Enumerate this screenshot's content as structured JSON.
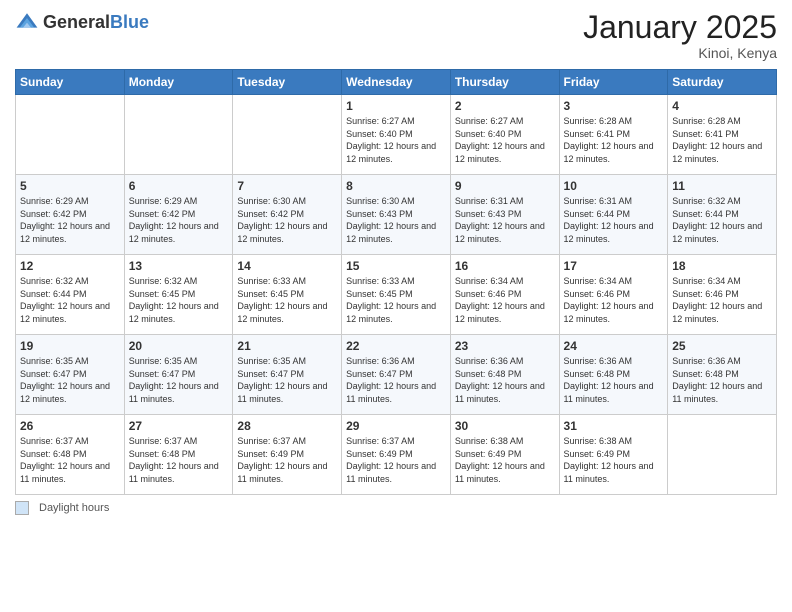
{
  "header": {
    "logo_general": "General",
    "logo_blue": "Blue",
    "month_title": "January 2025",
    "location": "Kinoi, Kenya"
  },
  "days_of_week": [
    "Sunday",
    "Monday",
    "Tuesday",
    "Wednesday",
    "Thursday",
    "Friday",
    "Saturday"
  ],
  "footer": {
    "box_label": "Daylight hours"
  },
  "weeks": [
    [
      {
        "day": "",
        "sunrise": "",
        "sunset": "",
        "daylight": ""
      },
      {
        "day": "",
        "sunrise": "",
        "sunset": "",
        "daylight": ""
      },
      {
        "day": "",
        "sunrise": "",
        "sunset": "",
        "daylight": ""
      },
      {
        "day": "1",
        "sunrise": "6:27 AM",
        "sunset": "6:40 PM",
        "daylight": "12 hours and 12 minutes."
      },
      {
        "day": "2",
        "sunrise": "6:27 AM",
        "sunset": "6:40 PM",
        "daylight": "12 hours and 12 minutes."
      },
      {
        "day": "3",
        "sunrise": "6:28 AM",
        "sunset": "6:41 PM",
        "daylight": "12 hours and 12 minutes."
      },
      {
        "day": "4",
        "sunrise": "6:28 AM",
        "sunset": "6:41 PM",
        "daylight": "12 hours and 12 minutes."
      }
    ],
    [
      {
        "day": "5",
        "sunrise": "6:29 AM",
        "sunset": "6:42 PM",
        "daylight": "12 hours and 12 minutes."
      },
      {
        "day": "6",
        "sunrise": "6:29 AM",
        "sunset": "6:42 PM",
        "daylight": "12 hours and 12 minutes."
      },
      {
        "day": "7",
        "sunrise": "6:30 AM",
        "sunset": "6:42 PM",
        "daylight": "12 hours and 12 minutes."
      },
      {
        "day": "8",
        "sunrise": "6:30 AM",
        "sunset": "6:43 PM",
        "daylight": "12 hours and 12 minutes."
      },
      {
        "day": "9",
        "sunrise": "6:31 AM",
        "sunset": "6:43 PM",
        "daylight": "12 hours and 12 minutes."
      },
      {
        "day": "10",
        "sunrise": "6:31 AM",
        "sunset": "6:44 PM",
        "daylight": "12 hours and 12 minutes."
      },
      {
        "day": "11",
        "sunrise": "6:32 AM",
        "sunset": "6:44 PM",
        "daylight": "12 hours and 12 minutes."
      }
    ],
    [
      {
        "day": "12",
        "sunrise": "6:32 AM",
        "sunset": "6:44 PM",
        "daylight": "12 hours and 12 minutes."
      },
      {
        "day": "13",
        "sunrise": "6:32 AM",
        "sunset": "6:45 PM",
        "daylight": "12 hours and 12 minutes."
      },
      {
        "day": "14",
        "sunrise": "6:33 AM",
        "sunset": "6:45 PM",
        "daylight": "12 hours and 12 minutes."
      },
      {
        "day": "15",
        "sunrise": "6:33 AM",
        "sunset": "6:45 PM",
        "daylight": "12 hours and 12 minutes."
      },
      {
        "day": "16",
        "sunrise": "6:34 AM",
        "sunset": "6:46 PM",
        "daylight": "12 hours and 12 minutes."
      },
      {
        "day": "17",
        "sunrise": "6:34 AM",
        "sunset": "6:46 PM",
        "daylight": "12 hours and 12 minutes."
      },
      {
        "day": "18",
        "sunrise": "6:34 AM",
        "sunset": "6:46 PM",
        "daylight": "12 hours and 12 minutes."
      }
    ],
    [
      {
        "day": "19",
        "sunrise": "6:35 AM",
        "sunset": "6:47 PM",
        "daylight": "12 hours and 12 minutes."
      },
      {
        "day": "20",
        "sunrise": "6:35 AM",
        "sunset": "6:47 PM",
        "daylight": "12 hours and 11 minutes."
      },
      {
        "day": "21",
        "sunrise": "6:35 AM",
        "sunset": "6:47 PM",
        "daylight": "12 hours and 11 minutes."
      },
      {
        "day": "22",
        "sunrise": "6:36 AM",
        "sunset": "6:47 PM",
        "daylight": "12 hours and 11 minutes."
      },
      {
        "day": "23",
        "sunrise": "6:36 AM",
        "sunset": "6:48 PM",
        "daylight": "12 hours and 11 minutes."
      },
      {
        "day": "24",
        "sunrise": "6:36 AM",
        "sunset": "6:48 PM",
        "daylight": "12 hours and 11 minutes."
      },
      {
        "day": "25",
        "sunrise": "6:36 AM",
        "sunset": "6:48 PM",
        "daylight": "12 hours and 11 minutes."
      }
    ],
    [
      {
        "day": "26",
        "sunrise": "6:37 AM",
        "sunset": "6:48 PM",
        "daylight": "12 hours and 11 minutes."
      },
      {
        "day": "27",
        "sunrise": "6:37 AM",
        "sunset": "6:48 PM",
        "daylight": "12 hours and 11 minutes."
      },
      {
        "day": "28",
        "sunrise": "6:37 AM",
        "sunset": "6:49 PM",
        "daylight": "12 hours and 11 minutes."
      },
      {
        "day": "29",
        "sunrise": "6:37 AM",
        "sunset": "6:49 PM",
        "daylight": "12 hours and 11 minutes."
      },
      {
        "day": "30",
        "sunrise": "6:38 AM",
        "sunset": "6:49 PM",
        "daylight": "12 hours and 11 minutes."
      },
      {
        "day": "31",
        "sunrise": "6:38 AM",
        "sunset": "6:49 PM",
        "daylight": "12 hours and 11 minutes."
      },
      {
        "day": "",
        "sunrise": "",
        "sunset": "",
        "daylight": ""
      }
    ]
  ]
}
